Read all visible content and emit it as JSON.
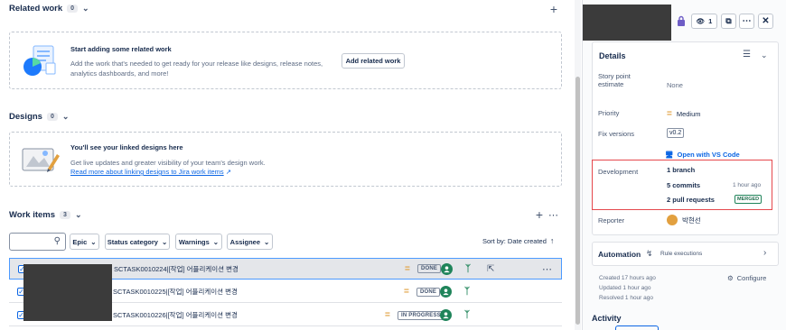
{
  "related_work": {
    "title": "Related work",
    "count": "0",
    "empty_title": "Start adding some related work",
    "empty_desc_1": "Add the work that's needed to get ready for your release like designs, release notes,",
    "empty_desc_2": "analytics dashboards, and more!",
    "add_button": "Add related work",
    "add_icon": "plus-icon"
  },
  "designs": {
    "title": "Designs",
    "count": "0",
    "empty_title": "You'll see your linked designs here",
    "empty_desc": "Get live updates and greater visibility of your team's design work.",
    "link_text": "Read more about linking designs to Jira work items"
  },
  "work_items": {
    "title": "Work items",
    "count": "3",
    "filters": [
      "Epic",
      "Status category",
      "Warnings",
      "Assignee"
    ],
    "sort_label": "Sort by: Date created",
    "rows": [
      {
        "key": "SCTASK0010224|[작업] 어플리케이션 변경",
        "status": "DONE",
        "priority_icon": "medium-priority-icon"
      },
      {
        "key": "SCTASK0010225|[작업] 어플리케이션 변경",
        "status": "DONE",
        "priority_icon": "medium-priority-icon"
      },
      {
        "key": "SCTASK0010226|[작업] 어플리케이션 변경",
        "status": "IN PROGRESS",
        "priority_icon": "medium-priority-icon"
      }
    ]
  },
  "header_right": {
    "watch_count": "1"
  },
  "details": {
    "title": "Details",
    "story_points_label": "Story point estimate",
    "story_points_value": "None",
    "priority_label": "Priority",
    "priority_value": "Medium",
    "fix_versions_label": "Fix versions",
    "fix_versions_value": "v0.2",
    "open_vscode": "Open with VS Code",
    "development_label": "Development",
    "branches": "1 branch",
    "commits": "5 commits",
    "commits_time": "1 hour ago",
    "pull_requests": "2 pull requests",
    "pr_status": "MERGED",
    "reporter_label": "Reporter",
    "reporter_value": "박현선"
  },
  "automation": {
    "title": "Automation",
    "rule_executions": "Rule executions"
  },
  "meta": {
    "created": "Created 17 hours ago",
    "updated": "Updated 1 hour ago",
    "resolved": "Resolved 1 hour ago",
    "configure": "Configure"
  },
  "activity": {
    "title": "Activity"
  },
  "colors": {
    "accent": "#0c66e4",
    "success": "#1f845a",
    "priority_medium": "#e2a03f",
    "highlight_border": "#e5484d"
  }
}
